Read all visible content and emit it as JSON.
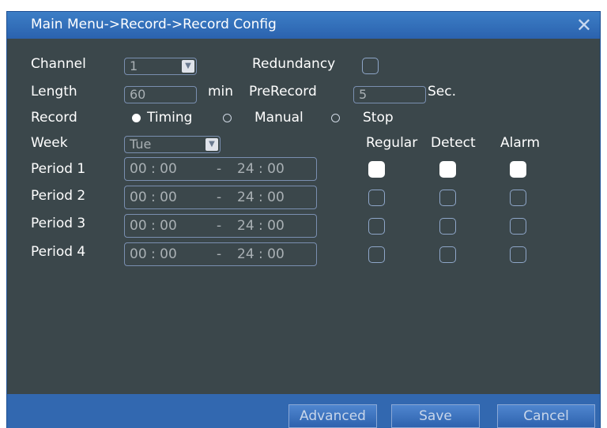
{
  "title": "Main Menu->Record->Record Config",
  "labels": {
    "channel": "Channel",
    "redundancy": "Redundancy",
    "length": "Length",
    "min": "min",
    "prerecord": "PreRecord",
    "sec": "Sec.",
    "record": "Record",
    "week": "Week",
    "regular": "Regular",
    "detect": "Detect",
    "alarm": "Alarm"
  },
  "fields": {
    "channel": "1",
    "length": "60",
    "prerecord": "5",
    "week": "Tue"
  },
  "record_modes": [
    {
      "label": "Timing",
      "selected": true
    },
    {
      "label": "Manual",
      "selected": false
    },
    {
      "label": "Stop",
      "selected": false
    }
  ],
  "periods": [
    {
      "label": "Period 1",
      "start": "00 : 00",
      "sep": "-",
      "end": "24 : 00",
      "regular": true,
      "detect": true,
      "alarm": true
    },
    {
      "label": "Period 2",
      "start": "00 : 00",
      "sep": "-",
      "end": "24 : 00",
      "regular": false,
      "detect": false,
      "alarm": false
    },
    {
      "label": "Period 3",
      "start": "00 : 00",
      "sep": "-",
      "end": "24 : 00",
      "regular": false,
      "detect": false,
      "alarm": false
    },
    {
      "label": "Period 4",
      "start": "00 : 00",
      "sep": "-",
      "end": "24 : 00",
      "regular": false,
      "detect": false,
      "alarm": false
    }
  ],
  "buttons": {
    "advanced": "Advanced",
    "save": "Save",
    "cancel": "Cancel"
  },
  "icons": {
    "close": "close-icon",
    "dropdown": "chevron-down-icon"
  },
  "colors": {
    "panel": "#3b474b",
    "titlebar": "#2b62ae",
    "bottombar": "#3268b0"
  }
}
